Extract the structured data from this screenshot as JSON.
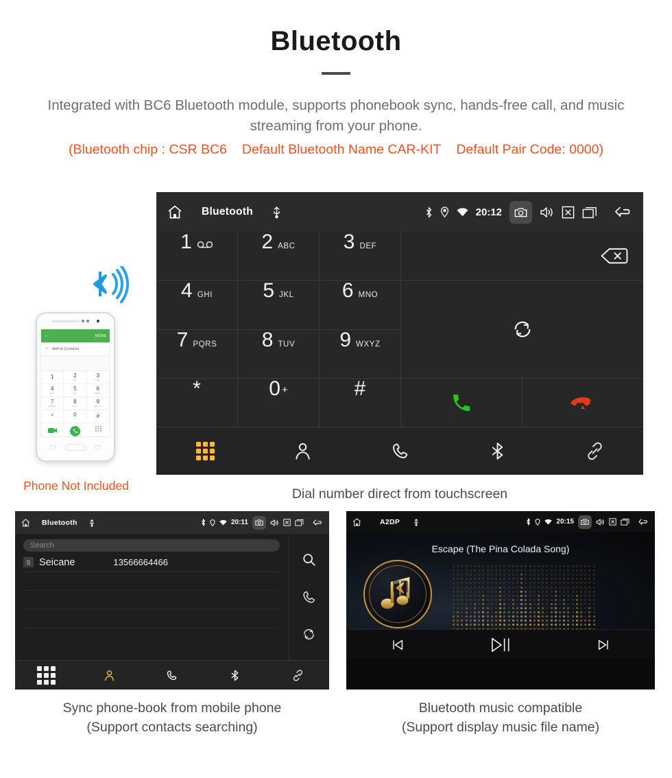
{
  "hero": {
    "title": "Bluetooth",
    "description": "Integrated with BC6 Bluetooth module, supports phonebook sync, hands-free call, and music streaming from your phone.",
    "spec_chip": "(Bluetooth chip : CSR BC6",
    "spec_name": "Default Bluetooth Name CAR-KIT",
    "spec_pair": "Default Pair Code: 0000)",
    "accent_color": "#f4511e",
    "body_color": "#6e6e6e"
  },
  "dialer": {
    "statusbar": {
      "title": "Bluetooth",
      "time": "20:12",
      "icons_left": [
        "home-icon",
        "usb-icon"
      ],
      "icons_right": [
        "bluetooth-icon",
        "location-icon",
        "wifi-icon",
        "camera-icon",
        "volume-icon",
        "close-box-icon",
        "recents-icon",
        "back-icon"
      ]
    },
    "keys": [
      {
        "num": "1",
        "sub": "⌥",
        "voicemail": true
      },
      {
        "num": "2",
        "sub": "ABC"
      },
      {
        "num": "3",
        "sub": "DEF"
      },
      {
        "num": "4",
        "sub": "GHI"
      },
      {
        "num": "5",
        "sub": "JKL"
      },
      {
        "num": "6",
        "sub": "MNO"
      },
      {
        "num": "7",
        "sub": "PQRS"
      },
      {
        "num": "8",
        "sub": "TUV"
      },
      {
        "num": "9",
        "sub": "WXYZ"
      },
      {
        "num": "*",
        "sub": ""
      },
      {
        "num": "0",
        "sup": "+",
        "sub": ""
      },
      {
        "num": "#",
        "sub": ""
      }
    ],
    "actions": {
      "backspace": "backspace-icon",
      "sync": "sync-icon",
      "call": "call-answer-icon",
      "hangup": "call-end-icon"
    },
    "tabs": [
      {
        "name": "dialpad",
        "icon": "dialpad-icon",
        "active": true
      },
      {
        "name": "contacts",
        "icon": "contacts-icon",
        "active": false
      },
      {
        "name": "call-log",
        "icon": "phone-icon",
        "active": false
      },
      {
        "name": "bluetooth",
        "icon": "bluetooth-icon",
        "active": false
      },
      {
        "name": "link",
        "icon": "link-icon",
        "active": false
      }
    ],
    "active_tab_color": "#f5b942",
    "caption": "Dial number direct from touchscreen"
  },
  "phone_mock": {
    "header_back": "←",
    "header_more": "MORE",
    "add_to_contacts": "Add to Contacts",
    "keys": [
      {
        "n": "1",
        "l": ""
      },
      {
        "n": "2",
        "l": "ABC"
      },
      {
        "n": "3",
        "l": "DEF"
      },
      {
        "n": "4",
        "l": "GHI"
      },
      {
        "n": "5",
        "l": "JKL"
      },
      {
        "n": "6",
        "l": "MNO"
      },
      {
        "n": "7",
        "l": "PQRS"
      },
      {
        "n": "8",
        "l": "TUV"
      },
      {
        "n": "9",
        "l": "WXYZ"
      },
      {
        "n": "*",
        "l": ""
      },
      {
        "n": "0",
        "l": "+"
      },
      {
        "n": "#",
        "l": ""
      }
    ],
    "header_color": "#4caf50",
    "note": "Phone Not Included",
    "bluetooth_signal_color": "#1b9ce3"
  },
  "phonebook": {
    "statusbar": {
      "title": "Bluetooth",
      "time": "20:11"
    },
    "search_placeholder": "Search",
    "contacts": [
      {
        "initial": "S",
        "name": "Seicane",
        "number": "13566664466"
      }
    ],
    "side_icons": [
      "search-icon",
      "phone-icon",
      "sync-icon"
    ],
    "tabs": [
      {
        "name": "dialpad",
        "icon": "dialpad-icon",
        "active": false
      },
      {
        "name": "contacts",
        "icon": "contacts-icon",
        "active": true
      },
      {
        "name": "call-log",
        "icon": "phone-icon",
        "active": false
      },
      {
        "name": "bluetooth",
        "icon": "bluetooth-icon",
        "active": false
      },
      {
        "name": "link",
        "icon": "link-icon",
        "active": false
      }
    ],
    "caption_line1": "Sync phone-book from mobile phone",
    "caption_line2": "(Support contacts searching)"
  },
  "music": {
    "statusbar": {
      "title": "A2DP",
      "time": "20:15"
    },
    "track_title": "Escape (The Pina Colada Song)",
    "logo_icon": "music-bluetooth-icon",
    "controls": [
      {
        "name": "previous",
        "icon": "skip-previous-icon"
      },
      {
        "name": "play-pause",
        "icon": "play-pause-icon"
      },
      {
        "name": "next",
        "icon": "skip-next-icon"
      }
    ],
    "accent_color": "#c9962f",
    "caption_line1": "Bluetooth music compatible",
    "caption_line2": "(Support display music file name)"
  }
}
